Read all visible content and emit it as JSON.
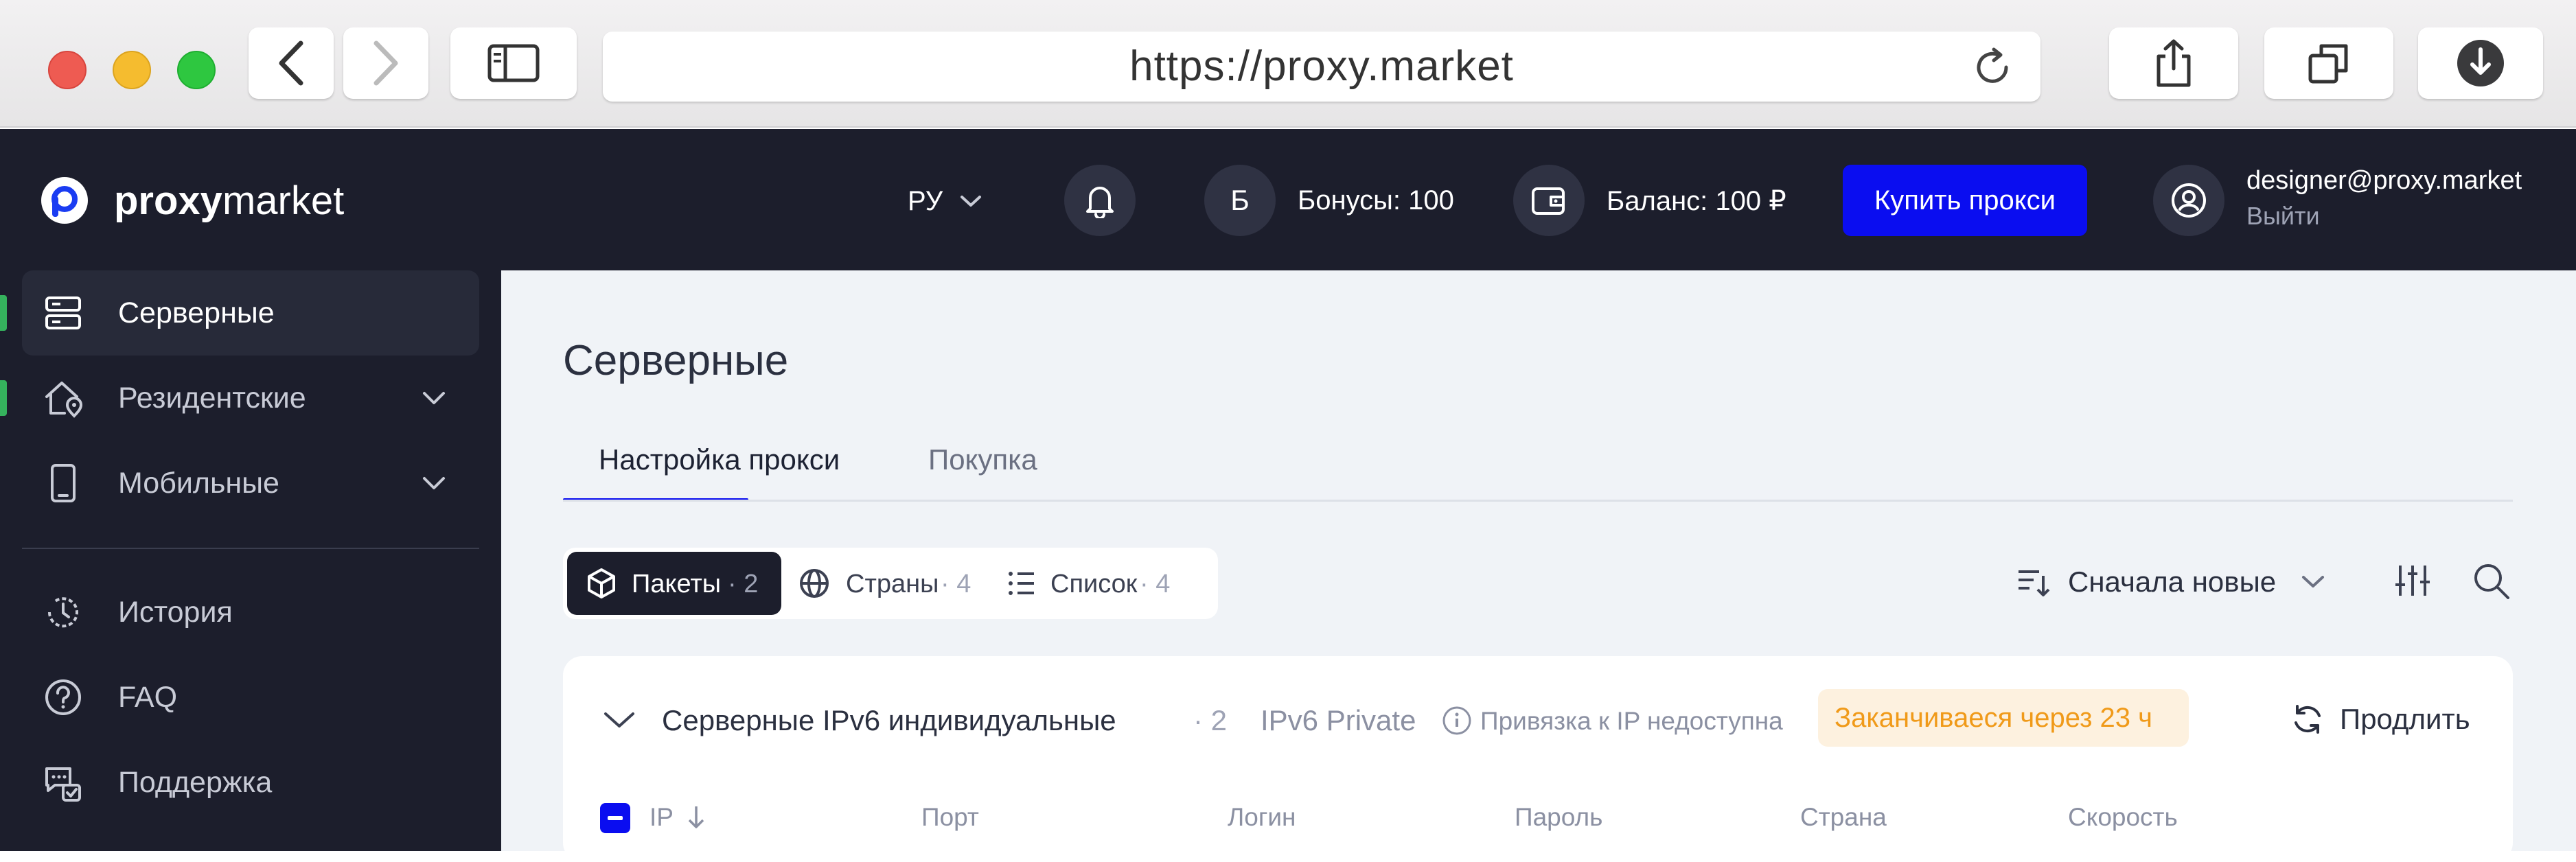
{
  "browser": {
    "url": "https://proxy.market",
    "icons": [
      "back-icon",
      "forward-icon",
      "sidebar-icon",
      "reload-icon",
      "share-icon",
      "tabs-icon",
      "download-icon"
    ]
  },
  "header": {
    "brand_a": "proxy",
    "brand_b": "market",
    "language": "РУ",
    "bonus_avatar": "Б",
    "bonus": "Бонусы: 100",
    "balance": "Баланс: 100 ₽",
    "buy_button": "Купить прокси",
    "user_email": "designer@proxy.market",
    "logout": "Выйти"
  },
  "sidebar": {
    "items": [
      {
        "label": "Серверные",
        "icon": "server-icon",
        "active": true
      },
      {
        "label": "Резидентские",
        "icon": "home-location-icon",
        "active": false
      },
      {
        "label": "Мобильные",
        "icon": "mobile-icon",
        "active": false
      },
      {
        "label": "История",
        "icon": "history-icon"
      },
      {
        "label": "FAQ",
        "icon": "question-icon"
      },
      {
        "label": "Поддержка",
        "icon": "support-chat-icon"
      }
    ]
  },
  "main": {
    "title": "Серверные",
    "tabs": [
      {
        "label": "Настройка прокси",
        "active": true
      },
      {
        "label": "Покупка",
        "active": false
      }
    ],
    "segments": [
      {
        "label": "Пакеты",
        "count": "· 2",
        "active": true
      },
      {
        "label": "Страны",
        "count": "· 4",
        "active": false
      },
      {
        "label": "Список",
        "count": "· 4",
        "active": false
      }
    ],
    "sort": "Сначала новые",
    "package": {
      "title": "Серверные IPv6 индивидуальные",
      "count": "· 2",
      "type": "IPv6 Private",
      "binding": "Привязка к IP недоступна",
      "expiry": "Заканчиваеся через 23 ч",
      "renew": "Продлить"
    },
    "table_headers": [
      "IP",
      "Порт",
      "Логин",
      "Пароль",
      "Страна",
      "Скорость"
    ]
  },
  "colors": {
    "accent_blue": "#0a0df0",
    "dark_bg": "#1c1e2c",
    "green_marker": "#35b25d",
    "warning_text": "#f09a19",
    "warning_bg": "#fdf1df"
  }
}
